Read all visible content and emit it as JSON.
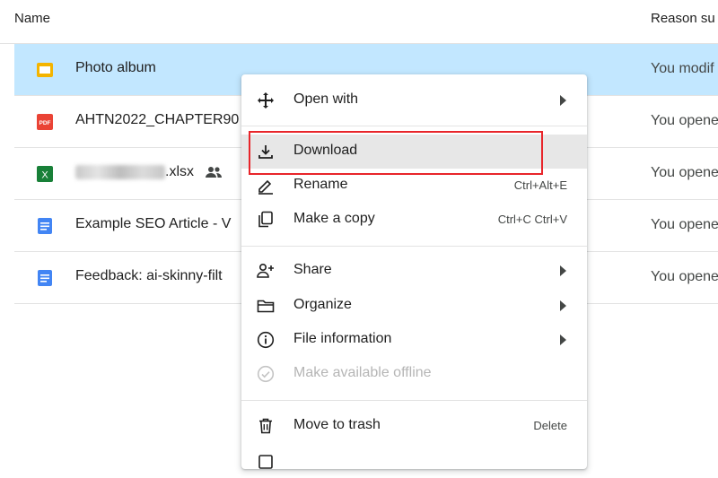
{
  "header": {
    "name_col": "Name",
    "reason_col": "Reason su"
  },
  "files": [
    {
      "name": "Photo album",
      "type": "slides-icon",
      "reason": "You modif",
      "selected": true
    },
    {
      "name": "AHTN2022_CHAPTER90",
      "type": "pdf-icon",
      "reason": "You opene"
    },
    {
      "name_suffix": ".xlsx",
      "type": "sheets-icon",
      "reason": "You opene",
      "shared": true
    },
    {
      "name": "Example SEO Article - V",
      "type": "docs-icon",
      "reason": "You opene"
    },
    {
      "name": "Feedback: ai-skinny-filt",
      "type": "docs-icon",
      "reason": "You opene"
    }
  ],
  "pdf_badge": "PDF",
  "sheets_badge": "X",
  "context_menu": {
    "items": [
      {
        "label": "Open with",
        "icon": "move-icon",
        "submenu": true
      },
      {
        "label": "Download",
        "icon": "download-icon",
        "highlighted": true
      },
      {
        "label": "Rename",
        "icon": "rename-icon",
        "shortcut": "Ctrl+Alt+E"
      },
      {
        "label": "Make a copy",
        "icon": "copy-icon",
        "shortcut": "Ctrl+C Ctrl+V"
      },
      {
        "label": "Share",
        "icon": "share-icon",
        "submenu": true
      },
      {
        "label": "Organize",
        "icon": "folder-icon",
        "submenu": true
      },
      {
        "label": "File information",
        "icon": "info-icon",
        "submenu": true
      },
      {
        "label": "Make available offline",
        "icon": "offline-icon",
        "disabled": true
      },
      {
        "label": "Move to trash",
        "icon": "trash-icon",
        "shortcut": "Delete"
      }
    ]
  },
  "colors": {
    "selection": "#c2e7ff",
    "highlight": "#e7e7e7",
    "annotation": "#e8252a"
  }
}
